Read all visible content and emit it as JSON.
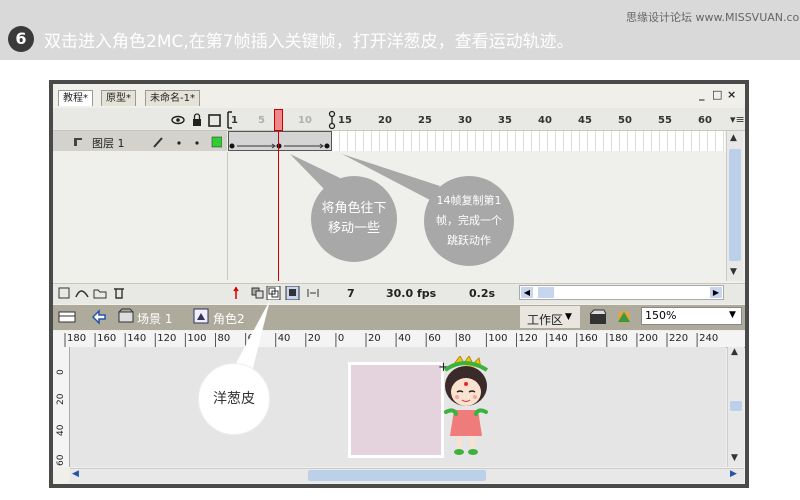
{
  "banner": {
    "step_number": "6",
    "instruction": "双击进入角色2MC,在第7帧插入关键帧，打开洋葱皮，查看运动轨迹。",
    "watermark": "思缘设计论坛 www.MISSVUAN.com"
  },
  "tabs": [
    {
      "label": "教程*",
      "active": true
    },
    {
      "label": "原型*",
      "active": false
    },
    {
      "label": "未命名-1*",
      "active": false
    }
  ],
  "window_controls": [
    "_",
    "□",
    "×"
  ],
  "timeline": {
    "frame_numbers": [
      "1",
      "5",
      "10",
      "15",
      "20",
      "25",
      "30",
      "35",
      "40",
      "45",
      "50",
      "55",
      "60"
    ],
    "current_frame": 7,
    "layer_name": "图层 1",
    "layer_color": "#33cc33",
    "status": {
      "frame": "7",
      "fps": "30.0 fps",
      "time": "0.2s"
    }
  },
  "editbar": {
    "scene": "场景 1",
    "symbol": "角色2",
    "workspace_label": "工作区",
    "zoom": "150%"
  },
  "ruler": {
    "h_ticks": [
      "180",
      "160",
      "140",
      "120",
      "100",
      "80",
      "60",
      "40",
      "20",
      "0",
      "20",
      "40",
      "60",
      "80",
      "100",
      "120",
      "140",
      "160",
      "180",
      "200",
      "220",
      "240"
    ],
    "v_ticks": [
      "0",
      "20",
      "40",
      "60"
    ]
  },
  "callouts": {
    "move_down": "将角色往下移动一些",
    "copy_frame": "14帧复制第1帧，完成一个跳跃动作",
    "onion_skin": "洋葱皮"
  },
  "colors": {
    "banner_bg": "#d9d9d9",
    "bubble_fill": "#a8a8a8",
    "playhead": "#d40000",
    "stage_box": "#e4d3dc"
  }
}
